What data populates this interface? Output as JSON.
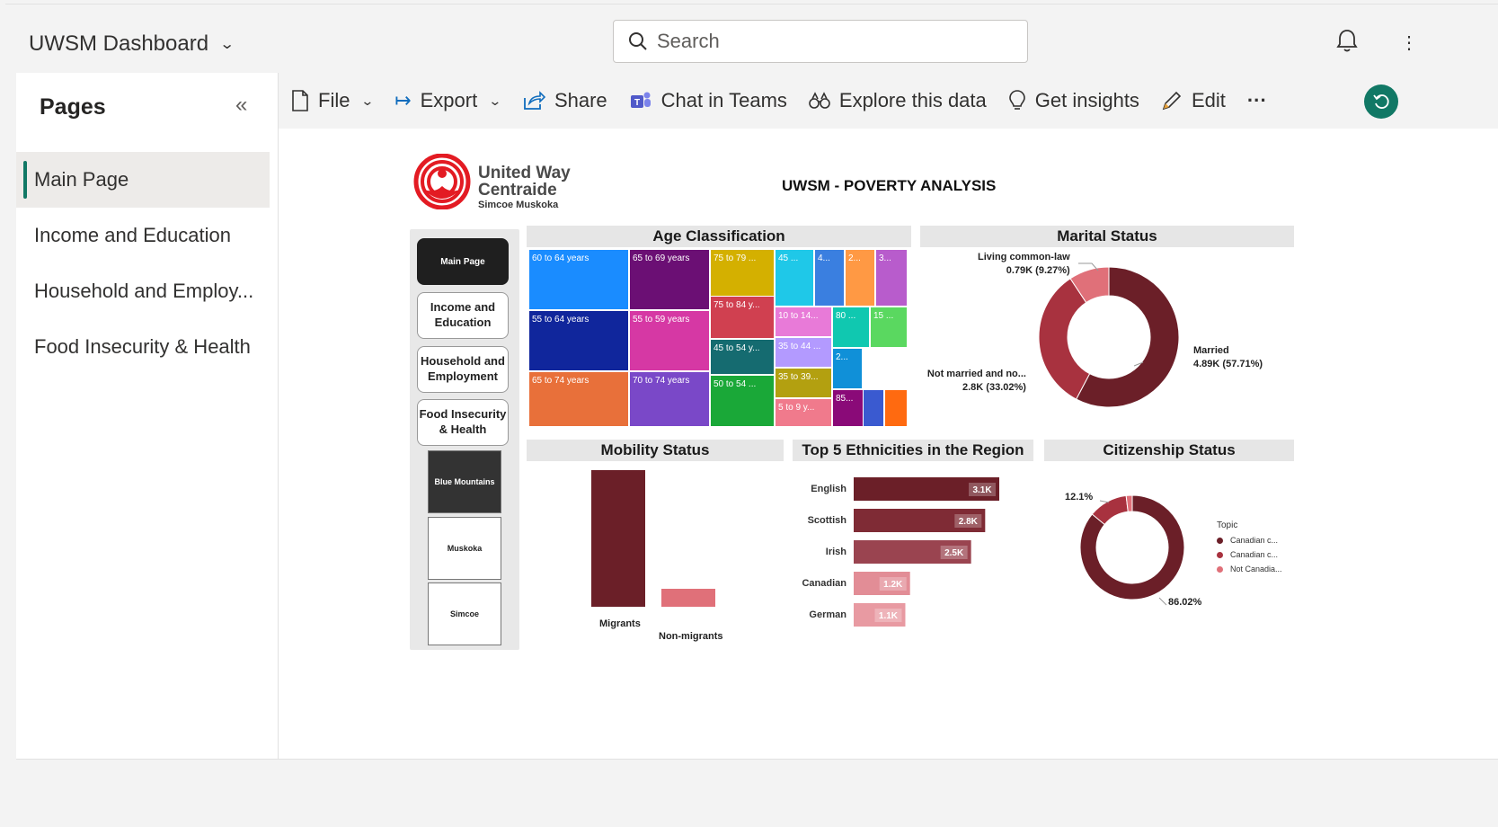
{
  "app": {
    "title": "UWSM Dashboard"
  },
  "search": {
    "placeholder": "Search"
  },
  "sidebar": {
    "heading": "Pages",
    "items": [
      {
        "label": "Main Page",
        "active": true
      },
      {
        "label": "Income and Education",
        "active": false
      },
      {
        "label": "Household and Employ...",
        "active": false
      },
      {
        "label": "Food Insecurity & Health",
        "active": false
      }
    ]
  },
  "toolbar": {
    "file": "File",
    "export": "Export",
    "share": "Share",
    "chat": "Chat in Teams",
    "explore": "Explore this data",
    "insights": "Get insights",
    "edit": "Edit",
    "more": "···"
  },
  "report": {
    "logo": {
      "line1": "United Way",
      "line2": "Centraide",
      "line3": "Simcoe Muskoka"
    },
    "title": "UWSM - POVERTY ANALYSIS",
    "nav_buttons": [
      "Main Page",
      "Income and Education",
      "Household and Employment",
      "Food Insecurity & Health"
    ],
    "region_buttons": [
      "Blue Mountains",
      "Muskoka",
      "Simcoe"
    ],
    "age": {
      "heading": "Age Classification",
      "cells": [
        "60 to 64 years",
        "65 to 69 years",
        "75 to 79 ...",
        "45 ...",
        "4...",
        "2...",
        "3...",
        "55 to 64 years",
        "55 to 59 years",
        "75 to 84 y...",
        "10 to 14...",
        "80 ...",
        "15 ...",
        "45 to 54 y...",
        "35 to 44 ...",
        "2...",
        "65 to 74 years",
        "70 to 74 years",
        "35 to 39...",
        "50 to 54 ...",
        "5 to 9 y...",
        "85..."
      ]
    },
    "marital": {
      "heading": "Marital Status",
      "labels": [
        {
          "name": "Living common-law",
          "value": "0.79K (9.27%)"
        },
        {
          "name": "Not married and no...",
          "value": "2.8K (33.02%)"
        },
        {
          "name": "Married",
          "value": "4.89K (57.71%)"
        }
      ]
    },
    "mobility": {
      "heading": "Mobility Status",
      "labels": [
        "Migrants",
        "Non-migrants"
      ]
    },
    "ethnic": {
      "heading": "Top 5 Ethnicities in the Region",
      "rows": [
        {
          "name": "English",
          "label": "3.1K"
        },
        {
          "name": "Scottish",
          "label": "2.8K"
        },
        {
          "name": "Irish",
          "label": "2.5K"
        },
        {
          "name": "Canadian",
          "label": "1.2K"
        },
        {
          "name": "German",
          "label": "1.1K"
        }
      ]
    },
    "citizenship": {
      "heading": "Citizenship Status",
      "label_small": "12.1%",
      "label_large": "86.02%",
      "legend_title": "Topic",
      "legend": [
        "Canadian c...",
        "Canadian c...",
        "Not Canadia..."
      ]
    }
  },
  "chart_data": [
    {
      "type": "pie",
      "title": "Marital Status",
      "categories": [
        "Married",
        "Not married and no...",
        "Living common-law"
      ],
      "values": [
        57.71,
        33.02,
        9.27
      ],
      "counts": [
        "4.89K",
        "2.8K",
        "0.79K"
      ],
      "colors": [
        "#6b1f28",
        "#a8323f",
        "#e07079"
      ]
    },
    {
      "type": "bar",
      "title": "Top 5 Ethnicities in the Region",
      "categories": [
        "English",
        "Scottish",
        "Irish",
        "Canadian",
        "German"
      ],
      "values": [
        3.1,
        2.8,
        2.5,
        1.2,
        1.1
      ],
      "unit": "K",
      "colors": [
        "#6b1f28",
        "#7f2b35",
        "#9a4450",
        "#e28d96",
        "#e89aa2"
      ]
    },
    {
      "type": "bar",
      "title": "Mobility Status",
      "categories": [
        "Migrants",
        "Non-migrants"
      ],
      "values": [
        100,
        13
      ],
      "colors": [
        "#6b1f28",
        "#e07079"
      ]
    },
    {
      "type": "pie",
      "title": "Citizenship Status",
      "categories": [
        "Canadian c...",
        "Canadian c...",
        "Not Canadia..."
      ],
      "values": [
        86.02,
        12.1,
        1.88
      ],
      "colors": [
        "#6b1f28",
        "#a8323f",
        "#e07079"
      ]
    }
  ]
}
